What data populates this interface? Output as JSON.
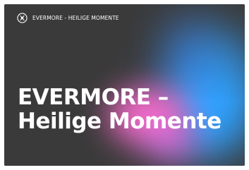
{
  "brand": {
    "text": "EVERMORE - HEILIGE MOMENTE",
    "logo_icon": "evermore-logo-icon"
  },
  "headline": {
    "line1": "EVERMORE –",
    "line2": "Heilige Momente"
  },
  "colors": {
    "background": "#3a3a3a",
    "accent_pink": "#f06ac8",
    "accent_blue": "#35a6ff",
    "text": "#ffffff"
  }
}
